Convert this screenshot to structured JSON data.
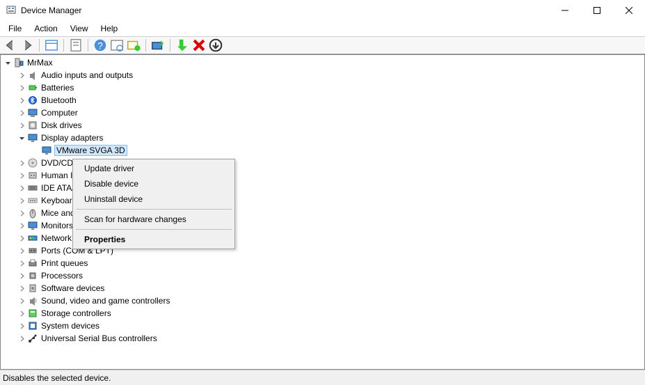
{
  "window": {
    "title": "Device Manager"
  },
  "menubar": {
    "items": [
      "File",
      "Action",
      "View",
      "Help"
    ]
  },
  "tree": {
    "root": {
      "label": "MrMax"
    },
    "nodes": [
      {
        "label": "Audio inputs and outputs",
        "icon": "audio"
      },
      {
        "label": "Batteries",
        "icon": "battery"
      },
      {
        "label": "Bluetooth",
        "icon": "bluetooth"
      },
      {
        "label": "Computer",
        "icon": "computer"
      },
      {
        "label": "Disk drives",
        "icon": "disk"
      },
      {
        "label": "Display adapters",
        "icon": "display",
        "expanded": true,
        "children": [
          {
            "label": "VMware SVGA 3D",
            "icon": "display",
            "selected": true
          }
        ]
      },
      {
        "label": "DVD/CD-ROM drives",
        "icon": "dvd"
      },
      {
        "label": "Human Interface Devices",
        "icon": "hid"
      },
      {
        "label": "IDE ATA/ATAPI controllers",
        "icon": "ide"
      },
      {
        "label": "Keyboards",
        "icon": "keyboard"
      },
      {
        "label": "Mice and other pointing devices",
        "icon": "mouse"
      },
      {
        "label": "Monitors",
        "icon": "monitor"
      },
      {
        "label": "Network adapters",
        "icon": "network"
      },
      {
        "label": "Ports (COM & LPT)",
        "icon": "port"
      },
      {
        "label": "Print queues",
        "icon": "print"
      },
      {
        "label": "Processors",
        "icon": "cpu"
      },
      {
        "label": "Software devices",
        "icon": "software"
      },
      {
        "label": "Sound, video and game controllers",
        "icon": "sound"
      },
      {
        "label": "Storage controllers",
        "icon": "storage"
      },
      {
        "label": "System devices",
        "icon": "system"
      },
      {
        "label": "Universal Serial Bus controllers",
        "icon": "usb"
      }
    ]
  },
  "context_menu": {
    "items": [
      {
        "label": "Update driver",
        "type": "item"
      },
      {
        "label": "Disable device",
        "type": "item"
      },
      {
        "label": "Uninstall device",
        "type": "item"
      },
      {
        "type": "sep"
      },
      {
        "label": "Scan for hardware changes",
        "type": "item"
      },
      {
        "type": "sep"
      },
      {
        "label": "Properties",
        "type": "item",
        "bold": true
      }
    ]
  },
  "statusbar": {
    "text": "Disables the selected device."
  }
}
